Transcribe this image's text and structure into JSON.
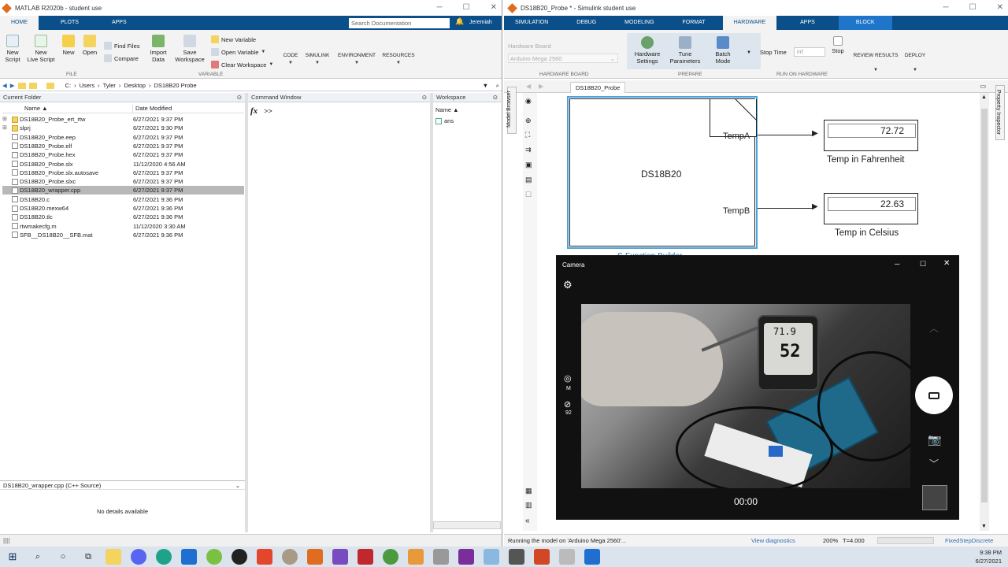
{
  "matlab": {
    "title": "MATLAB R2020b - student use",
    "search_placeholder": "Search Documentation",
    "user": "Jeremiah",
    "tabs": [
      "HOME",
      "PLOTS",
      "APPS"
    ],
    "ribbon": {
      "new_script": "New\nScript",
      "new_live_script": "New\nLive Script",
      "new": "New",
      "open": "Open",
      "find_files": "Find Files",
      "compare": "Compare",
      "import_data": "Import\nData",
      "save_workspace": "Save\nWorkspace",
      "new_variable": "New Variable",
      "open_variable": "Open Variable",
      "clear_workspace": "Clear Workspace",
      "code": "CODE",
      "simulink": "SIMULINK",
      "environment": "ENVIRONMENT",
      "resources": "RESOURCES",
      "file_section": "FILE",
      "variable_section": "VARIABLE"
    },
    "path": [
      "C:",
      "Users",
      "Tyler",
      "Desktop",
      "DS18B20 Probe"
    ],
    "current_folder_title": "Current Folder",
    "col_name": "Name",
    "col_date": "Date Modified",
    "files": [
      {
        "name": "DS18B20_Probe_ert_rtw",
        "date": "6/27/2021 9:37 PM",
        "type": "folder"
      },
      {
        "name": "slprj",
        "date": "6/27/2021 9:30 PM",
        "type": "folder"
      },
      {
        "name": "DS18B20_Probe.eep",
        "date": "6/27/2021 9:37 PM",
        "type": "file"
      },
      {
        "name": "DS18B20_Probe.elf",
        "date": "6/27/2021 9:37 PM",
        "type": "file"
      },
      {
        "name": "DS18B20_Probe.hex",
        "date": "6/27/2021 9:37 PM",
        "type": "file"
      },
      {
        "name": "DS18B20_Probe.slx",
        "date": "11/12/2020 4:56 AM",
        "type": "file"
      },
      {
        "name": "DS18B20_Probe.slx.autosave",
        "date": "6/27/2021 9:37 PM",
        "type": "file"
      },
      {
        "name": "DS18B20_Probe.slxc",
        "date": "6/27/2021 9:37 PM",
        "type": "file"
      },
      {
        "name": "DS18B20_wrapper.cpp",
        "date": "6/27/2021 9:37 PM",
        "type": "file",
        "selected": true
      },
      {
        "name": "DS18B20.c",
        "date": "6/27/2021 9:36 PM",
        "type": "file"
      },
      {
        "name": "DS18B20.mexw64",
        "date": "6/27/2021 9:36 PM",
        "type": "file"
      },
      {
        "name": "DS18B20.tlc",
        "date": "6/27/2021 9:36 PM",
        "type": "file"
      },
      {
        "name": "rtwmakecfg.m",
        "date": "11/12/2020 3:30 AM",
        "type": "file"
      },
      {
        "name": "SFB__DS18B20__SFB.mat",
        "date": "6/27/2021 9:36 PM",
        "type": "file"
      }
    ],
    "details_title": "DS18B20_wrapper.cpp  (C++ Source)",
    "details_empty": "No details available",
    "command_window_title": "Command Window",
    "prompt": ">>",
    "fx": "fx",
    "workspace_title": "Workspace",
    "workspace_col": "Name",
    "workspace_vars": [
      "ans"
    ]
  },
  "simulink": {
    "title": "DS18B20_Probe * - Simulink student use",
    "tabs": [
      "SIMULATION",
      "DEBUG",
      "MODELING",
      "FORMAT",
      "HARDWARE",
      "APPS",
      "BLOCK"
    ],
    "hardware_board_label": "Hardware Board",
    "hardware_board_value": "Arduino Mega 2560",
    "hardware_board_section": "HARDWARE BOARD",
    "hardware_settings": "Hardware\nSettings",
    "tune_parameters": "Tune\nParameters",
    "batch_mode": "Batch\nMode",
    "prepare_section": "PREPARE",
    "stop_time_label": "Stop Time",
    "stop_time_value": "inf",
    "stop": "Stop",
    "run_on_hardware": "RUN ON HARDWARE",
    "review_results": "REVIEW RESULTS",
    "deploy": "DEPLOY",
    "model_tab": "DS18B20_Probe",
    "model_browser": "Model Browser",
    "property_inspector": "Property Inspector",
    "block_name": "DS18B20",
    "port_a": "TempA",
    "port_b": "TempB",
    "block_caption": "S-Function Builder",
    "display1_value": "72.72",
    "display1_label": "Temp in Fahrenheit",
    "display2_value": "22.63",
    "display2_label": "Temp in Celsius",
    "status_text": "Running the model on 'Arduino Mega 2560'...",
    "view_diagnostics": "View diagnostics",
    "zoom": "200%",
    "time": "T=4.000",
    "solver": "FixedStepDiscrete"
  },
  "camera": {
    "title": "Camera",
    "mode_label": "M",
    "counter": "92",
    "timer": "00:00",
    "thermo_reading1": "71.9",
    "thermo_reading2": "52"
  },
  "taskbar": {
    "time": "9:38 PM",
    "date": "6/27/2021"
  }
}
